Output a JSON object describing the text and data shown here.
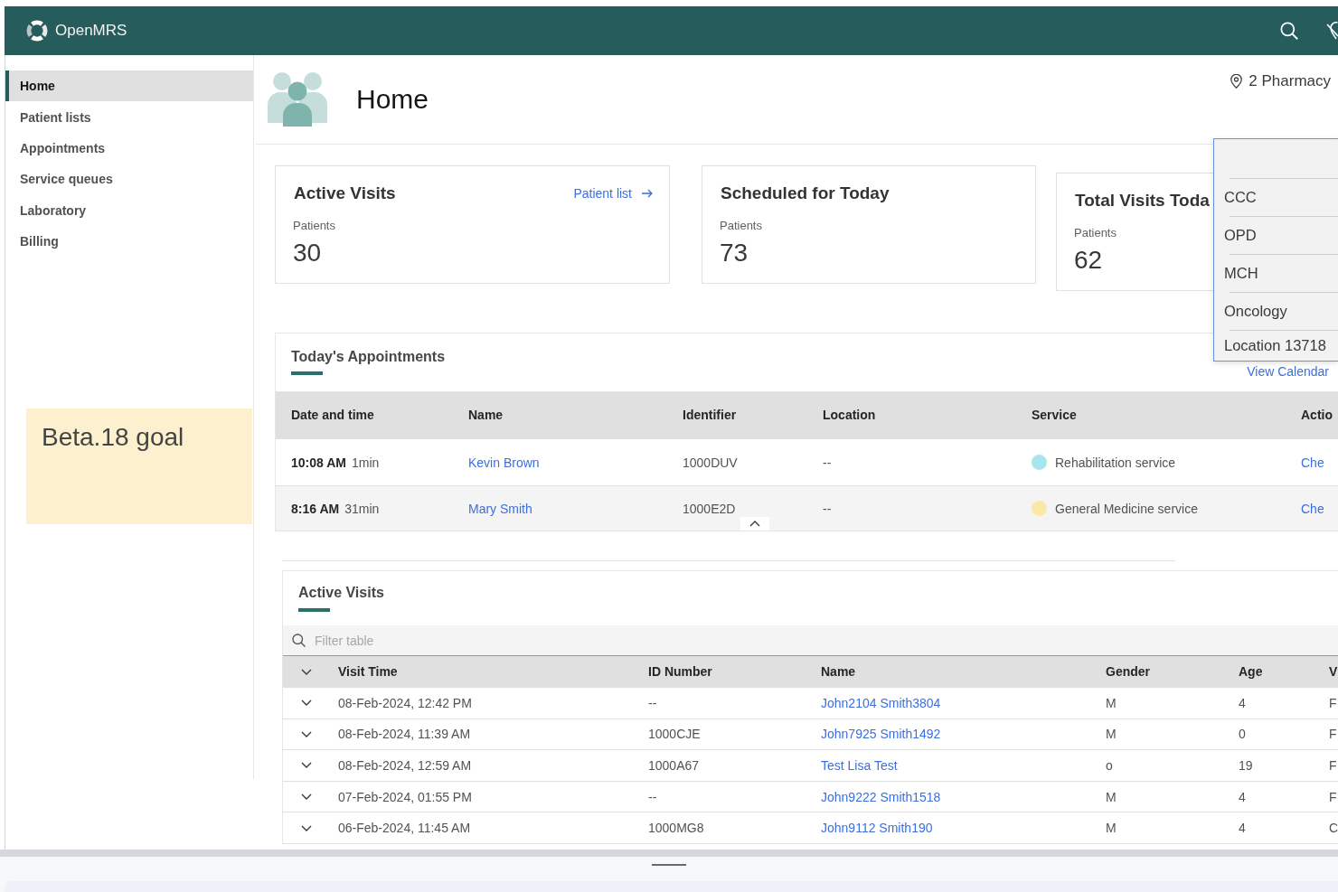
{
  "header": {
    "brand": "OpenMRS"
  },
  "sidebar": {
    "items": [
      {
        "label": "Home",
        "selected": true
      },
      {
        "label": "Patient lists",
        "selected": false
      },
      {
        "label": "Appointments",
        "selected": false
      },
      {
        "label": "Service queues",
        "selected": false
      },
      {
        "label": "Laboratory",
        "selected": false
      },
      {
        "label": "Billing",
        "selected": false
      }
    ]
  },
  "sticky_note": {
    "text": "Beta.18 goal"
  },
  "page_header": {
    "title": "Home",
    "location": "2 Pharmacy"
  },
  "metric_cards": [
    {
      "title": "Active Visits",
      "link": "Patient list",
      "label": "Patients",
      "value": "30"
    },
    {
      "title": "Scheduled for Today",
      "label": "Patients",
      "value": "73"
    },
    {
      "title": "Total Visits Toda",
      "label": "Patients",
      "value": "62"
    }
  ],
  "location_menu": {
    "options": [
      {
        "label": "CCC",
        "selected": false
      },
      {
        "label": "OPD",
        "selected": false
      },
      {
        "label": "MCH",
        "selected": false
      },
      {
        "label": "Oncology",
        "selected": false
      },
      {
        "label": "Location 13718",
        "selected": false
      }
    ]
  },
  "appointments": {
    "title": "Today's Appointments",
    "link": "View Calendar",
    "columns": [
      "Date and time",
      "Name",
      "Identifier",
      "Location",
      "Service",
      "Actio"
    ],
    "rows": [
      {
        "time": "10:08 AM",
        "duration": "1min",
        "name": "Kevin Brown",
        "identifier": "1000DUV",
        "location": "--",
        "service": "Rehabilitation service",
        "color": "#a6e7ef",
        "action": "Che"
      },
      {
        "time": "8:16 AM",
        "duration": "31min",
        "name": "Mary Smith",
        "identifier": "1000E2D",
        "location": "--",
        "service": "General Medicine service",
        "color": "#fbe8a6",
        "action": "Che"
      }
    ]
  },
  "active_visits": {
    "title": "Active Visits",
    "filter": {
      "placeholder": "Filter table"
    },
    "columns": [
      "Visit Time",
      "ID Number",
      "Name",
      "Gender",
      "Age",
      "V"
    ],
    "rows": [
      {
        "expanded": false,
        "visit_time": "08-Feb-2024, 12:42 PM",
        "id_number": "--",
        "name": "John2104 Smith3804",
        "gender": "M",
        "age": "4",
        "column_7": "F"
      },
      {
        "expanded": false,
        "visit_time": "08-Feb-2024, 11:39 AM",
        "id_number": "1000CJE",
        "name": "John7925 Smith1492",
        "gender": "M",
        "age": "0",
        "column_7": "F"
      },
      {
        "expanded": false,
        "visit_time": "08-Feb-2024, 12:59 AM",
        "id_number": "1000A67",
        "name": "Test Lisa Test",
        "gender": "o",
        "age": "19",
        "column_7": "F"
      },
      {
        "expanded": false,
        "visit_time": "07-Feb-2024, 01:55 PM",
        "id_number": "--",
        "name": "John9222 Smith1518",
        "gender": "M",
        "age": "4",
        "column_7": "F"
      },
      {
        "expanded": false,
        "visit_time": "06-Feb-2024, 11:45 AM",
        "id_number": "1000MG8",
        "name": "John9112 Smith190",
        "gender": "M",
        "age": "4",
        "column_7": "C"
      }
    ]
  }
}
